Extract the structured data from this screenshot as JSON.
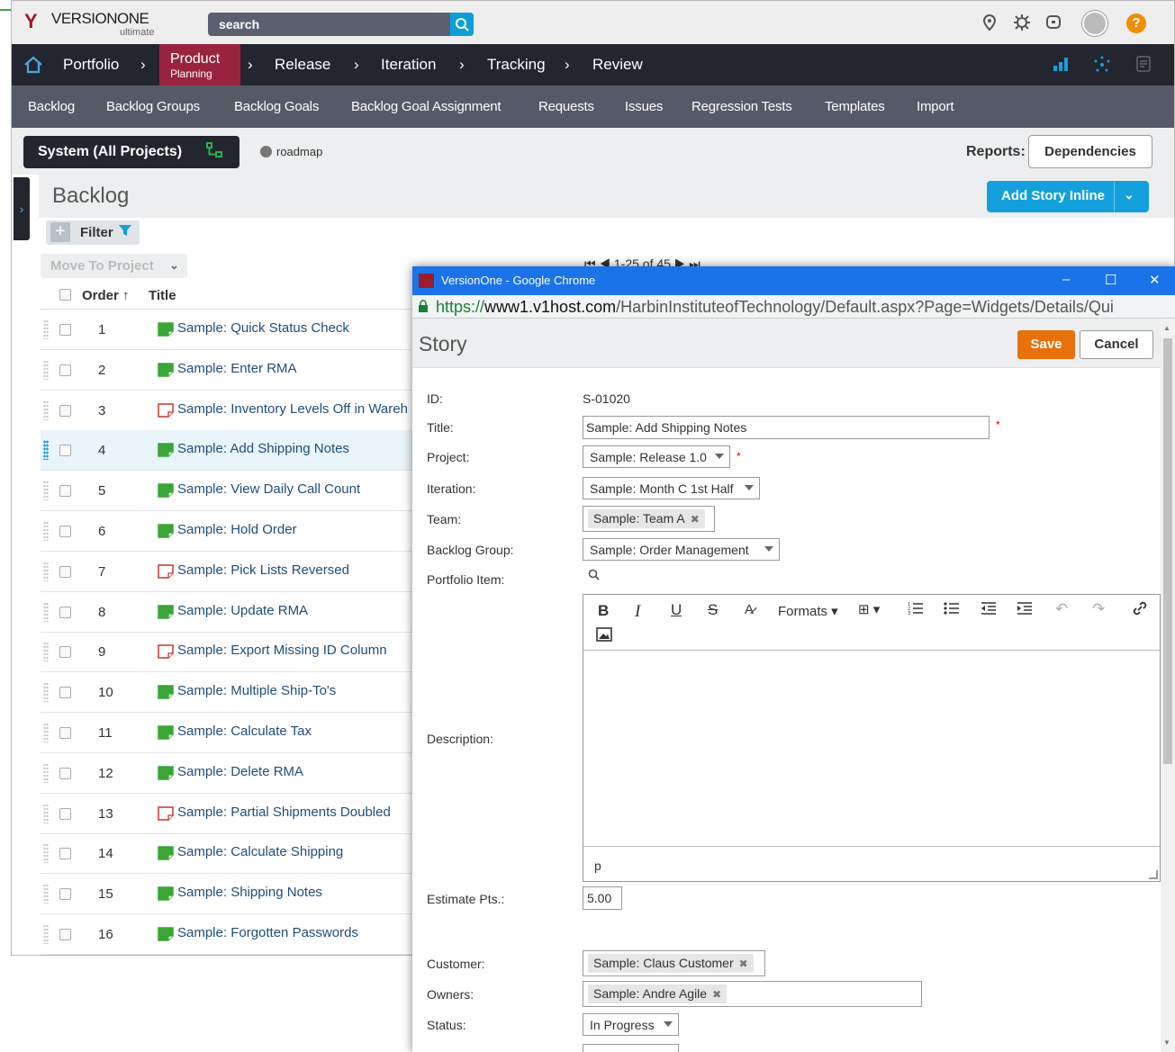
{
  "app": {
    "logo": {
      "name": "VERSIONONE",
      "edition": "ultimate"
    },
    "search": {
      "placeholder": "search"
    },
    "nav": {
      "portfolio": "Portfolio",
      "product_l1": "Product",
      "product_l2": "Planning",
      "release": "Release",
      "iteration": "Iteration",
      "tracking": "Tracking",
      "review": "Review"
    },
    "subnav": [
      "Backlog",
      "Backlog Groups",
      "Backlog Goals",
      "Backlog Goal Assignment",
      "Requests",
      "Issues",
      "Regression Tests",
      "Templates",
      "Import"
    ],
    "scope": {
      "label": "System (All Projects)",
      "roadmap": "roadmap",
      "reports_label": "Reports:",
      "dependencies": "Dependencies"
    },
    "backlog": {
      "title": "Backlog",
      "add_story": "Add Story Inline",
      "filter": "Filter",
      "move_to_project": "Move To Project",
      "pager": "⏮ ◀ 1-25 of 45 ▶ ⏭",
      "col_order": "Order ↑",
      "col_title": "Title",
      "rows": [
        {
          "order": "1",
          "title": "Sample: Quick Status Check",
          "type": "story"
        },
        {
          "order": "2",
          "title": "Sample: Enter RMA",
          "type": "story"
        },
        {
          "order": "3",
          "title": "Sample: Inventory Levels Off in Wareh",
          "type": "defect"
        },
        {
          "order": "4",
          "title": "Sample: Add Shipping Notes",
          "type": "story"
        },
        {
          "order": "5",
          "title": "Sample: View Daily Call Count",
          "type": "story"
        },
        {
          "order": "6",
          "title": "Sample: Hold Order",
          "type": "story"
        },
        {
          "order": "7",
          "title": "Sample: Pick Lists Reversed",
          "type": "defect"
        },
        {
          "order": "8",
          "title": "Sample: Update RMA",
          "type": "story"
        },
        {
          "order": "9",
          "title": "Sample: Export Missing ID Column",
          "type": "defect"
        },
        {
          "order": "10",
          "title": "Sample: Multiple Ship-To's",
          "type": "story"
        },
        {
          "order": "11",
          "title": "Sample: Calculate Tax",
          "type": "story"
        },
        {
          "order": "12",
          "title": "Sample: Delete RMA",
          "type": "story"
        },
        {
          "order": "13",
          "title": "Sample: Partial Shipments Doubled",
          "type": "defect"
        },
        {
          "order": "14",
          "title": "Sample: Calculate Shipping",
          "type": "story"
        },
        {
          "order": "15",
          "title": "Sample: Shipping Notes",
          "type": "story"
        },
        {
          "order": "16",
          "title": "Sample: Forgotten Passwords",
          "type": "story"
        }
      ]
    }
  },
  "popup": {
    "window_title": "VersionOne - Google Chrome",
    "url_scheme": "https://",
    "url_host": "www1.v1host.com",
    "url_path": "/HarbinInstituteofTechnology/Default.aspx?Page=Widgets/Details/Qui",
    "header": "Story",
    "save": "Save",
    "cancel": "Cancel",
    "labels": {
      "id": "ID:",
      "title": "Title:",
      "project": "Project:",
      "iteration": "Iteration:",
      "team": "Team:",
      "backlog_group": "Backlog Group:",
      "portfolio_item": "Portfolio Item:",
      "description": "Description:",
      "estimate": "Estimate Pts.:",
      "customer": "Customer:",
      "owners": "Owners:",
      "status": "Status:"
    },
    "values": {
      "id": "S-01020",
      "title": "Sample: Add Shipping Notes",
      "project": "Sample: Release 1.0",
      "iteration": "Sample: Month C 1st Half",
      "team": "Sample: Team A",
      "backlog_group": "Sample: Order Management",
      "estimate": "5.00",
      "customer": "Sample: Claus Customer",
      "owners": "Sample: Andre Agile",
      "status": "In Progress"
    },
    "editor": {
      "formats": "Formats",
      "status_path": "p"
    }
  },
  "colors": {
    "accent": "#14a0dc",
    "product_active": "#99233d",
    "save": "#e8710c",
    "chrome_titlebar": "#1a73e8"
  }
}
